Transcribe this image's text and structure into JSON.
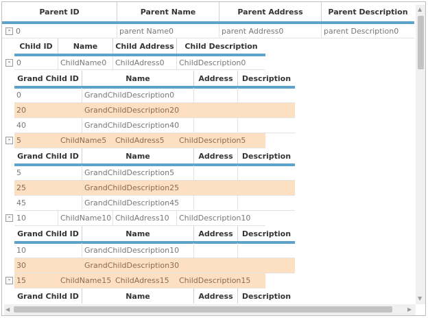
{
  "parent_headers": [
    "Parent ID",
    "Parent Name",
    "Parent Address",
    "Parent Description"
  ],
  "child_headers": [
    "Child ID",
    "Name",
    "Child Address",
    "Child Description"
  ],
  "grandchild_headers": [
    "Grand Child ID",
    "Name",
    "Address",
    "Description"
  ],
  "expander_glyph": "-",
  "parent_rows": [
    {
      "id": "0",
      "name": "parent Name0",
      "address": "parent Address0",
      "description": "parent Description0"
    }
  ],
  "child_rows": [
    {
      "id": "0",
      "name": "ChildName0",
      "address": "ChildAdress0",
      "description": "ChildDescription0",
      "highlighted": false
    },
    {
      "id": "5",
      "name": "ChildName5",
      "address": "ChildAdress5",
      "description": "ChildDescription5",
      "highlighted": true
    },
    {
      "id": "10",
      "name": "ChildName10",
      "address": "ChildAdress10",
      "description": "ChildDescription10",
      "highlighted": false
    },
    {
      "id": "15",
      "name": "ChildName15",
      "address": "ChildAdress15",
      "description": "ChildDescription15",
      "highlighted": true
    }
  ],
  "grandchild_groups": [
    {
      "rows": [
        {
          "id": "0",
          "name": "GrandChildDescription0",
          "highlighted": false
        },
        {
          "id": "20",
          "name": "GrandChildDescription20",
          "highlighted": true
        },
        {
          "id": "40",
          "name": "GrandChildDescription40",
          "highlighted": false
        }
      ]
    },
    {
      "rows": [
        {
          "id": "5",
          "name": "GrandChildDescription5",
          "highlighted": false
        },
        {
          "id": "25",
          "name": "GrandChildDescription25",
          "highlighted": true
        },
        {
          "id": "45",
          "name": "GrandChildDescription45",
          "highlighted": false
        }
      ]
    },
    {
      "rows": [
        {
          "id": "10",
          "name": "GrandChildDescription10",
          "highlighted": false
        },
        {
          "id": "30",
          "name": "GrandChildDescription30",
          "highlighted": true
        }
      ]
    },
    {
      "rows": []
    }
  ],
  "colors": {
    "accent": "#5ba2cc",
    "highlight": "#fde0c2"
  },
  "scrollbar_arrows": {
    "up": "▲",
    "down": "▼",
    "left": "◀",
    "right": "▶"
  }
}
